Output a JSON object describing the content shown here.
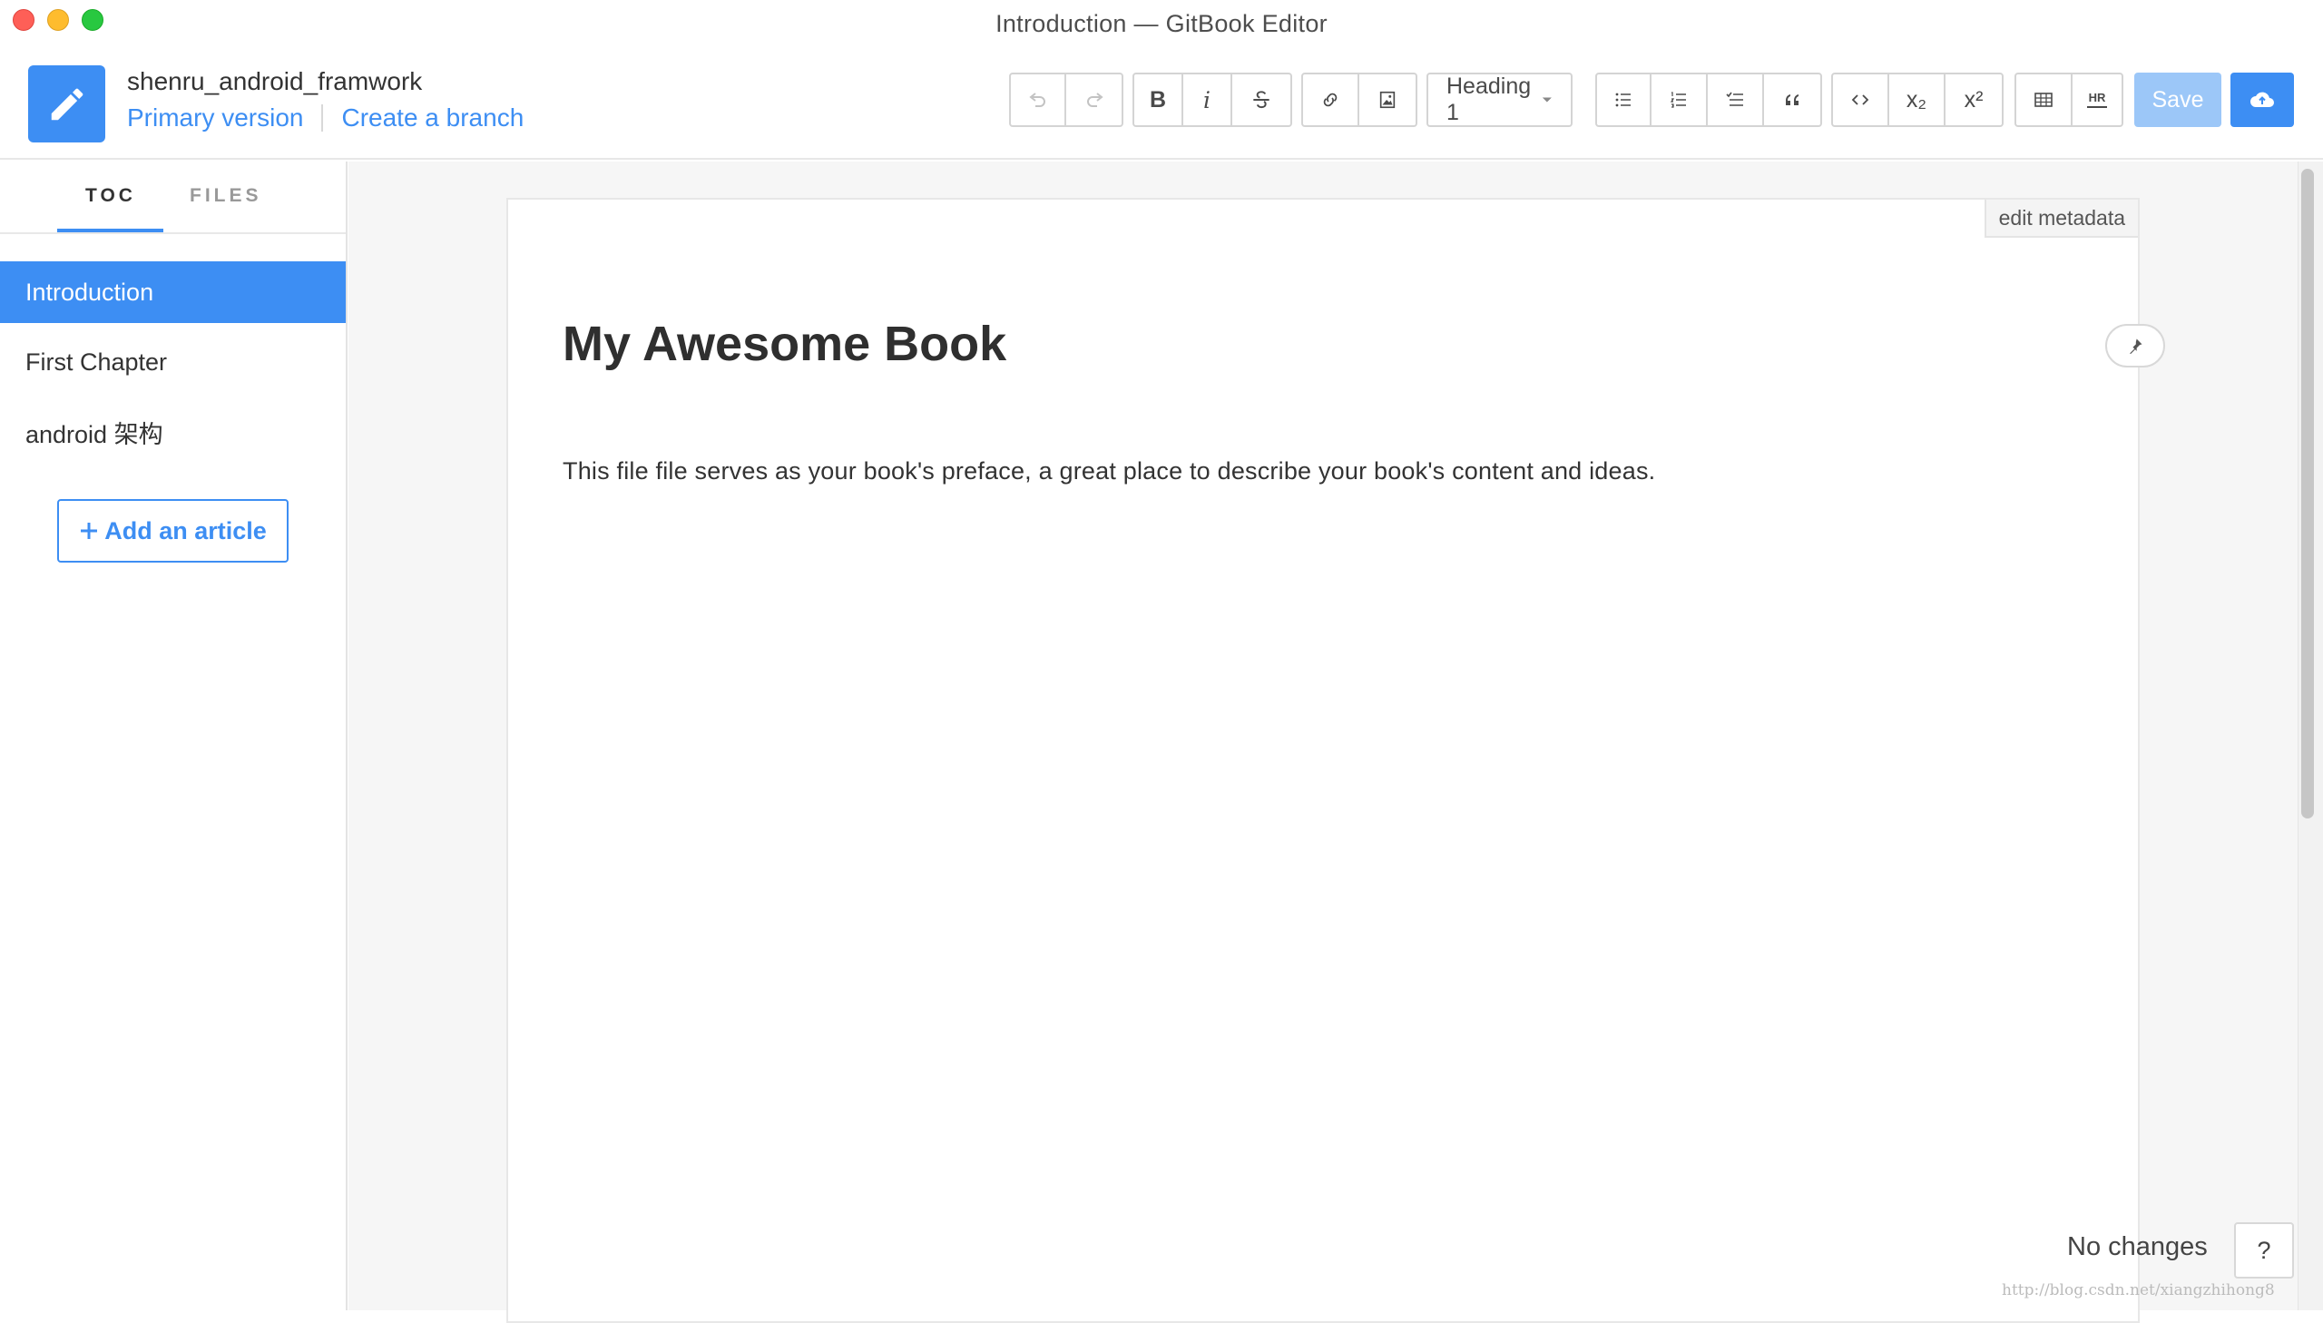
{
  "window": {
    "title": "Introduction — GitBook Editor"
  },
  "header": {
    "book_title": "shenru_android_framwork",
    "primary_version": "Primary version",
    "create_branch": "Create a branch"
  },
  "toolbar": {
    "heading_select": "Heading 1",
    "bold": "B",
    "italic": "i",
    "save": "Save",
    "subscript": "x₂",
    "superscript": "x²",
    "hr": "HR"
  },
  "sidebar": {
    "tabs": [
      "TOC",
      "FILES"
    ],
    "items": [
      {
        "label": "Introduction",
        "active": true
      },
      {
        "label": "First Chapter",
        "active": false
      },
      {
        "label": "android 架构",
        "active": false
      }
    ],
    "add_article": "Add an article"
  },
  "editor": {
    "edit_metadata": "edit metadata",
    "heading": "My Awesome Book",
    "paragraph": "This file file serves as your book's preface, a great place to describe your book's content and ideas."
  },
  "status": {
    "text": "No changes",
    "help": "?"
  },
  "watermark": "http://blog.csdn.net/xiangzhihong8",
  "colors": {
    "accent": "#3d8ef3",
    "save_disabled": "#9cc7f8"
  }
}
